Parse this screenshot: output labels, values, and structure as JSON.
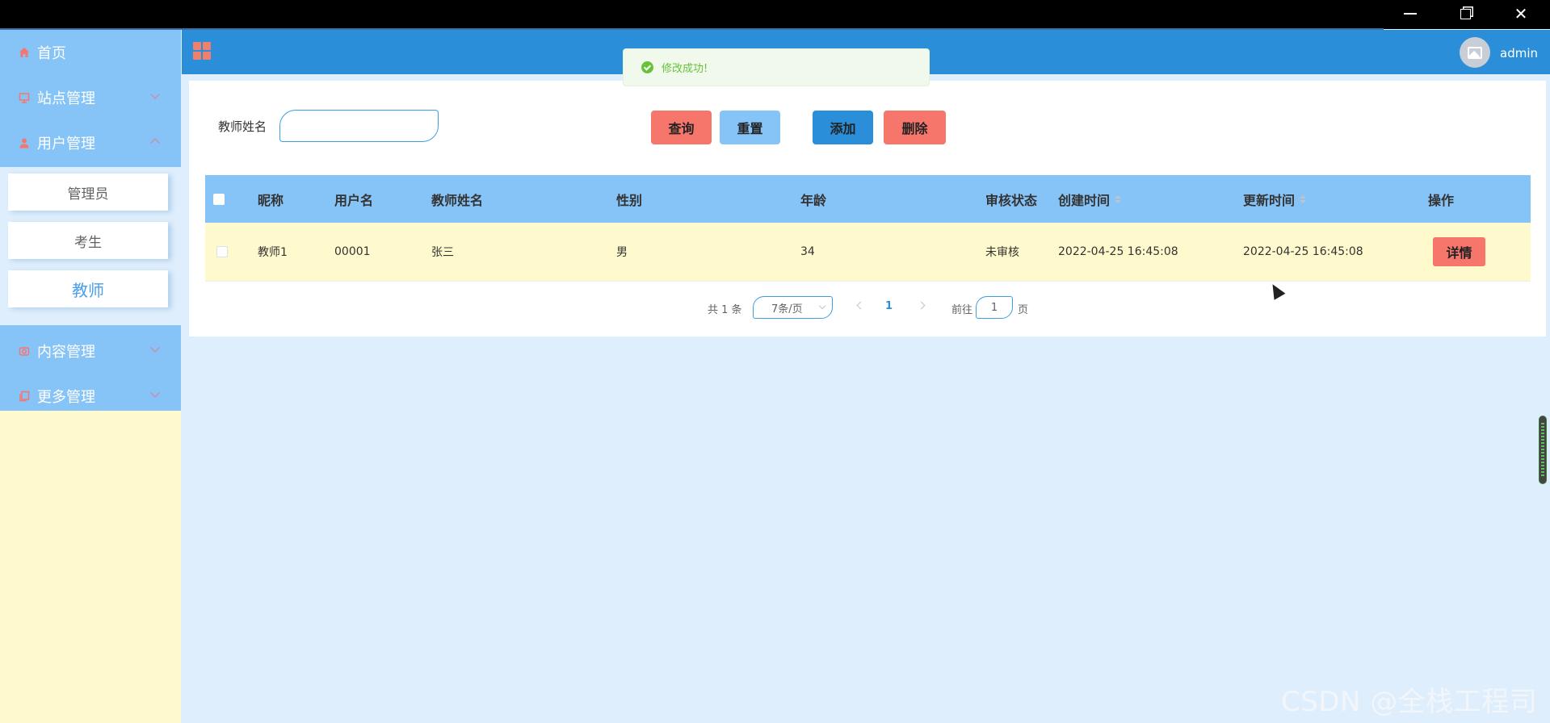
{
  "window": {
    "buttons": [
      "minimize",
      "restore",
      "close"
    ]
  },
  "sidebar": {
    "items": [
      {
        "label": "首页",
        "icon": "home-icon",
        "icon_color": "#f6766c"
      },
      {
        "label": "站点管理",
        "icon": "monitor-icon",
        "icon_color": "#f6766c",
        "expanded": false
      },
      {
        "label": "用户管理",
        "icon": "user-icon",
        "icon_color": "#f6766c",
        "expanded": true
      },
      {
        "label": "内容管理",
        "icon": "camera-icon",
        "icon_color": "#f6766c",
        "expanded": false
      },
      {
        "label": "更多管理",
        "icon": "copy-icon",
        "icon_color": "#f6766c",
        "expanded": false
      }
    ],
    "submenu": [
      {
        "label": "管理员",
        "active": false
      },
      {
        "label": "考生",
        "active": false
      },
      {
        "label": "教师",
        "active": true
      }
    ]
  },
  "header": {
    "title": "",
    "user": "admin",
    "bg_color": "#2a8fd8"
  },
  "toast": {
    "message": "修改成功!",
    "type": "success"
  },
  "search": {
    "label": "教师姓名",
    "value": "",
    "placeholder": ""
  },
  "actions": {
    "query": "查询",
    "reset": "重置",
    "add": "添加",
    "delete": "删除"
  },
  "table": {
    "columns": [
      "昵称",
      "用户名",
      "教师姓名",
      "性别",
      "年龄",
      "审核状态",
      "创建时间",
      "更新时间",
      "操作"
    ],
    "rows": [
      {
        "nickname": "教师1",
        "username": "00001",
        "teacher_name": "张三",
        "gender": "男",
        "age": "34",
        "status": "未审核",
        "created": "2022-04-25 16:45:08",
        "updated": "2022-04-25 16:45:08",
        "action": "详情"
      }
    ]
  },
  "pagination": {
    "total": "共 1 条",
    "page_size": "7条/页",
    "current_page": "1",
    "goto_label": "前往",
    "goto_value": "1",
    "page_suffix": "页"
  },
  "watermark": "CSDN @全栈工程司",
  "colors": {
    "accent_blue": "#2a8fd8",
    "light_blue": "#86c3f6",
    "coral": "#f6766c",
    "cream": "#fffacd",
    "success_green": "#67c23a"
  }
}
